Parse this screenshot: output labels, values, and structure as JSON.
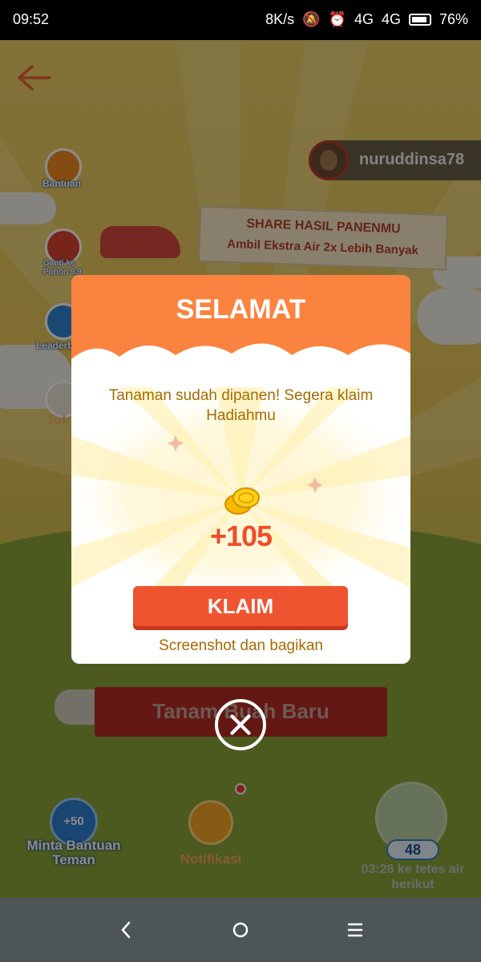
{
  "status_bar": {
    "time": "09:52",
    "speed": "8K/s",
    "network1": "4G",
    "network2": "4G",
    "battery": "76%"
  },
  "user": {
    "name": "nuruddinsa78"
  },
  "side_menu": [
    {
      "label": "Bantuan",
      "icon": "help-icon"
    },
    {
      "label": "Ganti ke Pohon 9.9",
      "icon": "tree-icon"
    },
    {
      "label": "Leaderb",
      "icon": "leaderboard-icon"
    },
    {
      "label": "Tok",
      "icon": "shop-icon"
    }
  ],
  "banner": {
    "line1": "SHARE HASIL PANENMU",
    "line2": "Ambil Ekstra Air 2x Lebih Banyak"
  },
  "background_button": "Tanam Buah Baru",
  "bottom_bar": {
    "help_badge": "+50",
    "help_label": "Minta Bantuan Teman",
    "notif_label": "Notifikasi",
    "water_count": "48",
    "timer": "03:28 ke tetes air berikut"
  },
  "modal": {
    "title": "SELAMAT",
    "message": "Tanaman sudah dipanen! Segera klaim Hadiahmu",
    "reward": "+105",
    "claim_label": "KLAIM",
    "share_label": "Screenshot dan bagikan"
  },
  "colors": {
    "header": "#fb8340",
    "claim": "#ef5430",
    "text_gold": "#a66b00",
    "reward": "#ef4d2a"
  }
}
